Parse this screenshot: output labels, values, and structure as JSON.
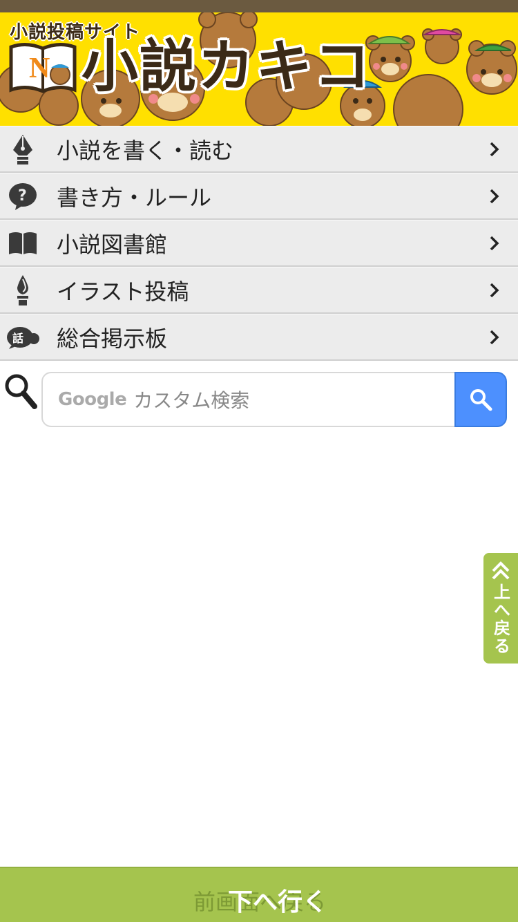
{
  "header": {
    "subtitle": "小説投稿サイト",
    "title": "小説カキコ",
    "logo_letter": "N",
    "banner_color": "#ffe000"
  },
  "menu": {
    "items": [
      {
        "label": "小説を書く・読む",
        "icon": "pen-nib-icon"
      },
      {
        "label": "書き方・ルール",
        "icon": "question-icon"
      },
      {
        "label": "小説図書館",
        "icon": "book-icon"
      },
      {
        "label": "イラスト投稿",
        "icon": "brush-icon"
      },
      {
        "label": "総合掲示板",
        "icon": "speech-bubble-icon"
      }
    ],
    "chat_icon_text": "話"
  },
  "search": {
    "brand": "Google",
    "placeholder": "カスタム検索",
    "button_color": "#4d90fe"
  },
  "side_tab": {
    "label": "上へ戻る",
    "color": "#a5c44e"
  },
  "bottom_bar": {
    "back_label": "前画面へ戻る",
    "next_label": "下へ行く",
    "color": "#a5c44e"
  }
}
